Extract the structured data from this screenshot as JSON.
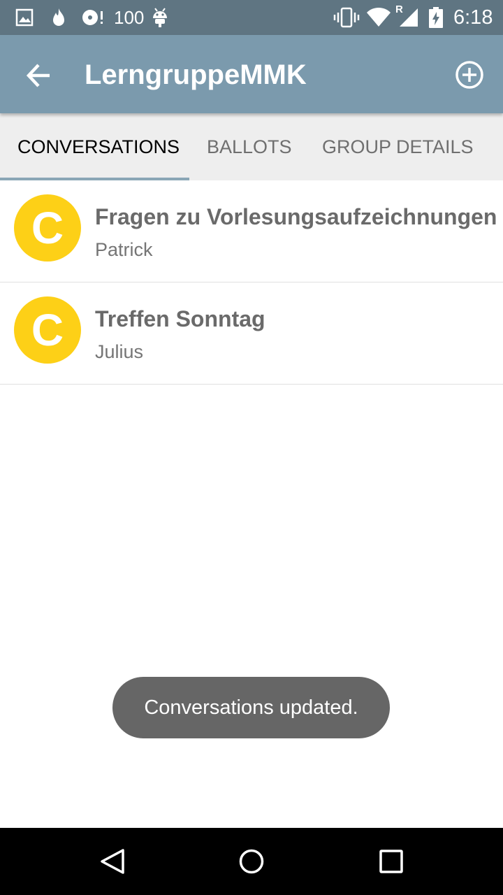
{
  "status_bar": {
    "notification_count": "100",
    "time": "6:18",
    "network_label": "R",
    "icons": [
      "image-icon",
      "flame-icon",
      "disc-alert-icon",
      "android-icon",
      "vibrate-icon",
      "wifi-icon",
      "cell-signal-icon",
      "battery-charging-icon"
    ]
  },
  "app_bar": {
    "title": "LerngruppeMMK",
    "back_icon": "arrow-back-icon",
    "add_icon": "add-circle-icon"
  },
  "tabs": [
    {
      "label": "CONVERSATIONS",
      "active": true
    },
    {
      "label": "BALLOTS",
      "active": false
    },
    {
      "label": "GROUP DETAILS",
      "active": false
    }
  ],
  "conversations": [
    {
      "avatar_letter": "C",
      "title": "Fragen zu Vorlesungsaufzeichnungen",
      "author": "Patrick"
    },
    {
      "avatar_letter": "C",
      "title": "Treffen Sonntag",
      "author": "Julius"
    }
  ],
  "toast": {
    "message": "Conversations updated."
  },
  "colors": {
    "status_bar": "#5f7582",
    "app_bar": "#7b9aad",
    "avatar": "#fdd017",
    "tab_indicator": "#8aa6b6",
    "toast": "#666666"
  },
  "nav_bar": {
    "icons": [
      "back-triangle-icon",
      "home-circle-icon",
      "recents-square-icon"
    ]
  }
}
